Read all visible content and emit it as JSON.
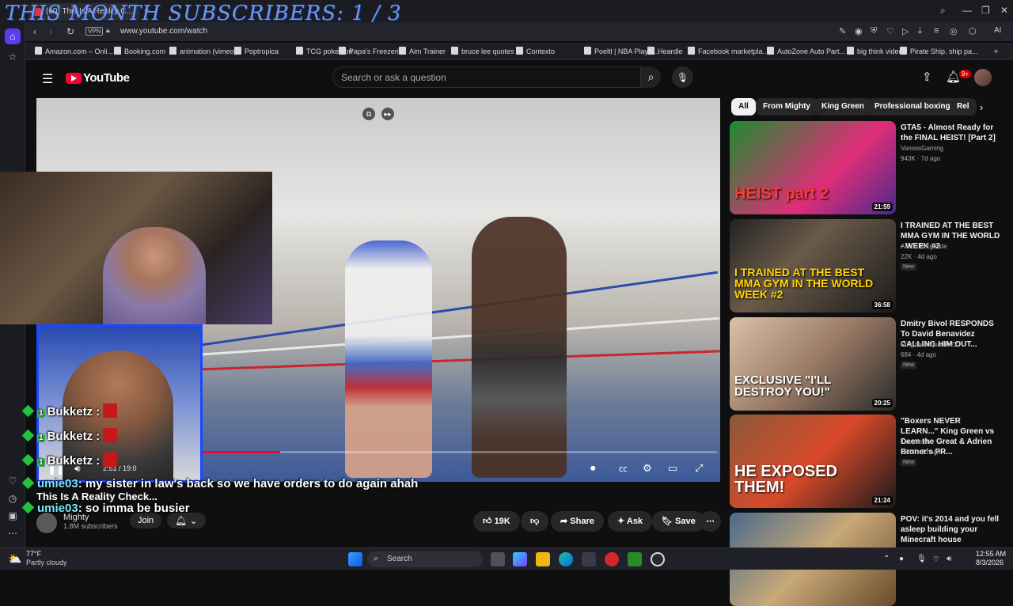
{
  "browser": {
    "tab_title": "(60) This Is A Reality C...",
    "new_tab": "+",
    "vpn": "VPN",
    "url": "www.youtube.com/watch",
    "toolbar_ai": "AI",
    "bookmarks": [
      "Amazon.com – Onli...",
      "Booking.com",
      "animation (vimeo)",
      "Poptropica",
      "TCG pokemon",
      "Papa's Freezeria",
      "Aim Trainer",
      "bruce lee quotes",
      "Contexto",
      "Poeltl | NBA Player...",
      "Heardle",
      "Facebook marketpla...",
      "AutoZone Auto Part...",
      "big think videos",
      "Pirate Ship. ship pa..."
    ]
  },
  "youtube": {
    "logo": "YouTube",
    "search_placeholder": "Search or ask a question",
    "notif_count": "9+",
    "chips": [
      "All",
      "From Mighty",
      "King Green",
      "Professional boxing",
      "Rel"
    ],
    "video": {
      "time": "2:51 / 19:0",
      "progress": 0.15,
      "title": "This Is A Reality Check...",
      "channel": "Mighty",
      "subscribers": "1.8M subscribers",
      "join": "Join",
      "likes": "19K",
      "share": "Share",
      "ask": "Ask",
      "save": "Save"
    },
    "recommendations": [
      {
        "title": "GTA5 - Almost Ready for the FINAL HEIST! [Part 2]",
        "channel": "VanossGaming",
        "meta": "943K · 7d ago",
        "new": "",
        "duration": "21:59",
        "thumb_text": "HEIST part 2"
      },
      {
        "title": "I TRAINED AT THE BEST MMA GYM IN THE WORLD - WEEK #2",
        "channel": "Alexei Pergande",
        "meta": "22K · 4d ago",
        "new": "New",
        "duration": "36:58",
        "thumb_text": "I TRAINED AT THE BEST MMA GYM IN THE WORLD WEEK #2"
      },
      {
        "title": "Dmitry Bivol RESPONDS To David Benavidez CALLING HIM OUT...",
        "channel": "Ring HeadquarterZZ",
        "meta": "684 · 4d ago",
        "new": "New",
        "duration": "20:25",
        "thumb_text": "EXCLUSIVE \"I'LL DESTROY YOU!\""
      },
      {
        "title": "\"Boxers NEVER LEARN...\" King Green vs Deen the Great & Adrien Broner's PR...",
        "channel": "Tim Welch",
        "meta": "186K · 2d ago",
        "new": "New",
        "duration": "21:24",
        "thumb_text": "HE EXPOSED THEM!"
      },
      {
        "title": "POV: it's 2014 and you fell asleep building your Minecraft house",
        "channel": "",
        "meta": "",
        "new": "",
        "duration": "",
        "thumb_text": ""
      }
    ]
  },
  "stream_overlay": {
    "title": "THIS MONTH SUBSCRIBERS: 1 / 3",
    "chat": [
      {
        "user": "Bukketz :",
        "message": ""
      },
      {
        "user": "Bukketz :",
        "message": ""
      },
      {
        "user": "Bukketz :",
        "message": ""
      },
      {
        "user": "umie03",
        "message": ": my sister in law's back so we have orders to do again ahah"
      },
      {
        "user": "umie03",
        "message": ": so imma be busier"
      }
    ]
  },
  "taskbar": {
    "weather_temp": "77°F",
    "weather_desc": "Partly cloudy",
    "search": "Search",
    "time": "12:55 AM",
    "date": "8/3/2026"
  },
  "colors": {
    "yt_red": "#ff0033",
    "chat_badge": "#23c43b",
    "cam_border": "#1a48ff"
  }
}
